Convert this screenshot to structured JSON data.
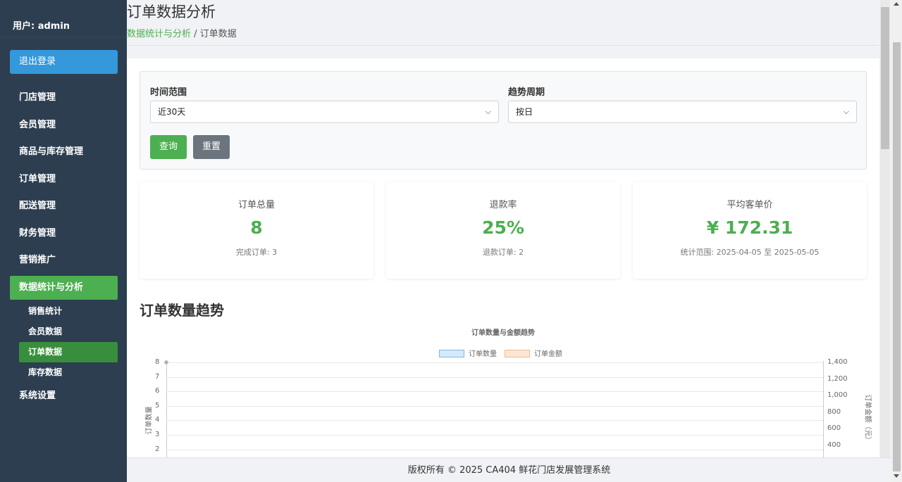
{
  "sidebar": {
    "user": "用户: admin",
    "logout": "退出登录",
    "items": [
      {
        "label": "门店管理"
      },
      {
        "label": "会员管理"
      },
      {
        "label": "商品与库存管理"
      },
      {
        "label": "订单管理"
      },
      {
        "label": "配送管理"
      },
      {
        "label": "财务管理"
      },
      {
        "label": "营销推广"
      },
      {
        "label": "数据统计与分析",
        "active": true
      },
      {
        "label": "系统设置"
      }
    ],
    "subitems": [
      {
        "label": "销售统计"
      },
      {
        "label": "会员数据"
      },
      {
        "label": "订单数据",
        "active": true
      },
      {
        "label": "库存数据"
      }
    ]
  },
  "header": {
    "title": "订单数据分析",
    "breadcrumb_link": "数据统计与分析",
    "breadcrumb_sep": " / ",
    "breadcrumb_current": "订单数据"
  },
  "filter": {
    "range_label": "时间范围",
    "range_value": "近30天",
    "period_label": "趋势周期",
    "period_value": "按日",
    "query_btn": "查询",
    "reset_btn": "重置"
  },
  "cards": [
    {
      "title": "订单总量",
      "value": "8",
      "sub": "完成订单: 3"
    },
    {
      "title": "退款率",
      "value": "25%",
      "sub": "退款订单: 2"
    },
    {
      "title": "平均客单价",
      "value": "¥ 172.31",
      "sub": "统计范围: 2025-04-05 至 2025-05-05"
    }
  ],
  "section_title": "订单数量趋势",
  "chart_data": {
    "type": "line",
    "title": "订单数量与金额趋势",
    "series": [
      {
        "name": "订单数量",
        "color": "#7fb7e6",
        "values": [
          8
        ]
      },
      {
        "name": "订单金额",
        "color": "#f5b98a",
        "values": [
          1378.48
        ]
      }
    ],
    "ylabel": "订单数量",
    "y2label": "订单金额（元）",
    "yticks_left": [
      "8",
      "7",
      "6",
      "5",
      "4",
      "3",
      "2"
    ],
    "yticks_right": [
      "1,400",
      "1,200",
      "1,000",
      "800",
      "600",
      "400"
    ],
    "ylim": [
      0,
      8
    ],
    "y2lim": [
      0,
      1400
    ],
    "grid": true,
    "legend": "top-center"
  },
  "footer": "版权所有 © 2025 CA404 鲜花门店发展管理系统"
}
